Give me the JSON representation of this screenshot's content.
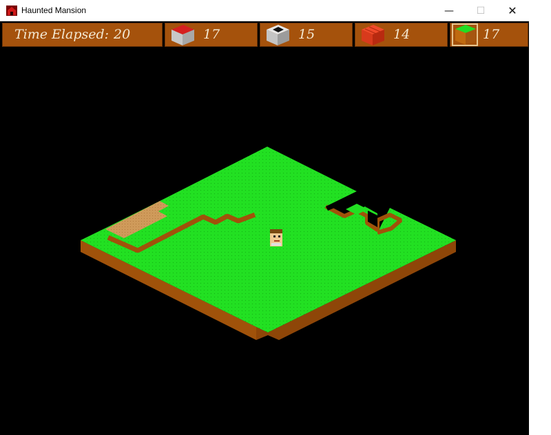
{
  "window": {
    "title": "Haunted Mansion",
    "minimize_glyph": "—",
    "maximize_glyph": "☐",
    "close_glyph": "✕"
  },
  "hud": {
    "time_label": "Time Elapsed:",
    "time_value": "20",
    "inventory": [
      {
        "block": "red-roof-block-icon",
        "count": "17"
      },
      {
        "block": "stone-block-icon",
        "count": "15"
      },
      {
        "block": "brick-block-icon",
        "count": "14"
      },
      {
        "block": "grass-block-icon",
        "count": "17",
        "selected": true
      }
    ]
  },
  "colors": {
    "hud_panel": "#a5520c",
    "hud_text": "#f3e8d2",
    "grass": "#22e022",
    "dirt_side": "#a0520a",
    "path": "#cf9a5a",
    "background": "#000000"
  }
}
